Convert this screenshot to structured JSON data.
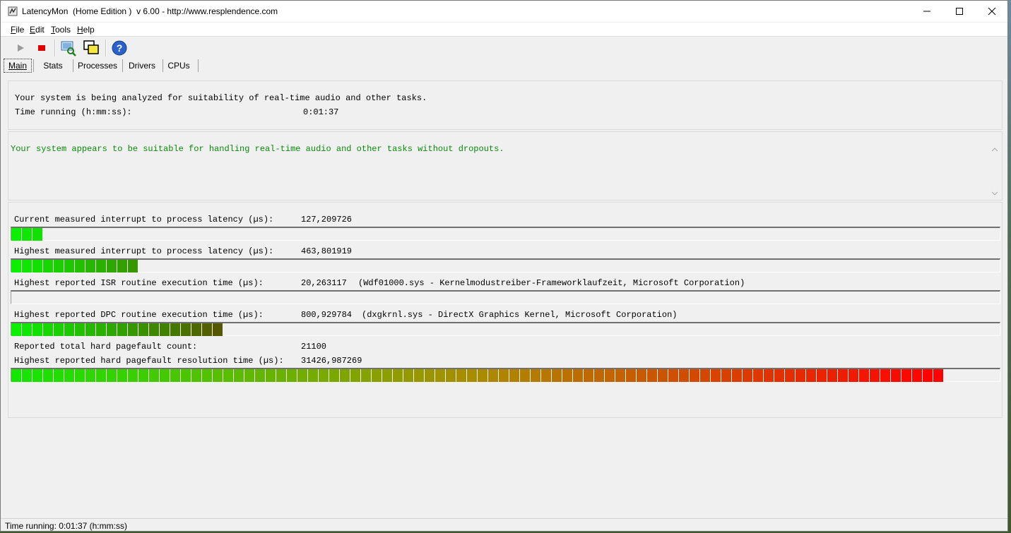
{
  "window": {
    "title": "LatencyMon  (Home Edition )  v 6.00 - http://www.resplendence.com"
  },
  "menu": [
    {
      "key": "F",
      "rest": "ile"
    },
    {
      "key": "E",
      "rest": "dit"
    },
    {
      "key": "T",
      "rest": "ools"
    },
    {
      "key": "H",
      "rest": "elp"
    }
  ],
  "toolbar": {
    "icons": [
      "start-icon",
      "stop-icon",
      "driver-analyze-icon",
      "windows-icon",
      "help-icon"
    ],
    "colors": {
      "start": "#9a9a9a",
      "stop": "#e00000",
      "help": "#2a62c9"
    }
  },
  "tabs": [
    "Main",
    "Stats",
    "Processes",
    "Drivers",
    "CPUs"
  ],
  "active_tab": "Main",
  "status_panel": {
    "line1": "Your system is being analyzed for suitability of real-time audio and other tasks.",
    "time_label": "Time running (h:mm:ss):",
    "time_value": "0:01:37"
  },
  "conclusion": {
    "text": "Your system appears to be suitable for handling real-time audio and other tasks without dropouts.",
    "color": "#0a8a0a"
  },
  "metrics": [
    {
      "label": "Current measured interrupt to process latency (µs):",
      "value": "127,209726",
      "detail": "",
      "bar_fraction": 0.033
    },
    {
      "label": "Highest measured interrupt to process latency (µs):",
      "value": "463,801919",
      "detail": "",
      "bar_fraction": 0.136
    },
    {
      "label": "Highest reported ISR routine execution time (µs):",
      "value": "20,263117",
      "detail": "(Wdf01000.sys - Kernelmodustreiber-Frameworklaufzeit, Microsoft Corporation)",
      "bar_fraction": 0
    },
    {
      "label": "Highest reported DPC routine execution time (µs):",
      "value": "800,929784",
      "detail": "(dxgkrnl.sys - DirectX Graphics Kernel, Microsoft Corporation)",
      "bar_fraction": 0.228
    },
    {
      "label": "Reported total hard pagefault count:",
      "value": "21100",
      "detail": ""
    },
    {
      "label": "Highest reported hard pagefault resolution time (µs):",
      "value": "31426,987269",
      "detail": "",
      "bar_fraction": 1.0
    }
  ],
  "statusbar": {
    "text": "Time running: 0:01:37  (h:mm:ss)"
  }
}
